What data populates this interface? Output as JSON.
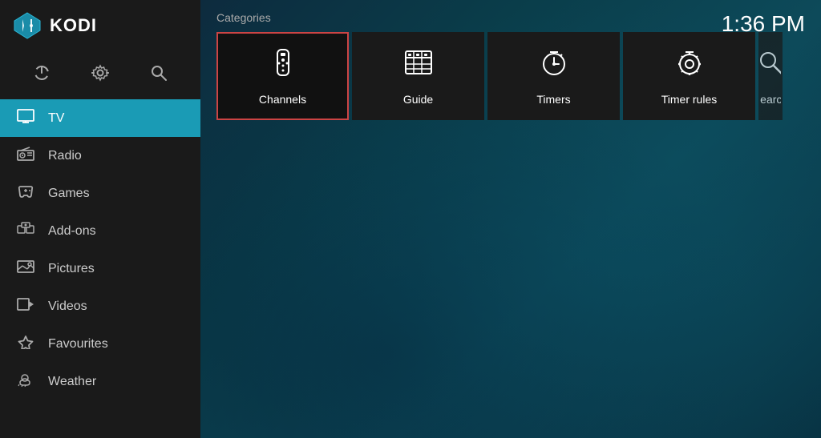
{
  "clock": "1:36 PM",
  "kodi_title": "KODI",
  "sidebar": {
    "system_icon": "⏻",
    "settings_icon": "⚙",
    "search_icon": "🔍",
    "nav_items": [
      {
        "id": "tv",
        "label": "TV",
        "active": true
      },
      {
        "id": "radio",
        "label": "Radio",
        "active": false
      },
      {
        "id": "games",
        "label": "Games",
        "active": false
      },
      {
        "id": "addons",
        "label": "Add-ons",
        "active": false
      },
      {
        "id": "pictures",
        "label": "Pictures",
        "active": false
      },
      {
        "id": "videos",
        "label": "Videos",
        "active": false
      },
      {
        "id": "favourites",
        "label": "Favourites",
        "active": false
      },
      {
        "id": "weather",
        "label": "Weather",
        "active": false
      }
    ]
  },
  "categories_label": "Categories",
  "categories": [
    {
      "id": "channels",
      "label": "Channels",
      "selected": true
    },
    {
      "id": "guide",
      "label": "Guide",
      "selected": false
    },
    {
      "id": "timers",
      "label": "Timers",
      "selected": false
    },
    {
      "id": "timer-rules",
      "label": "Timer rules",
      "selected": false
    },
    {
      "id": "search",
      "label": "Search",
      "selected": false
    }
  ]
}
